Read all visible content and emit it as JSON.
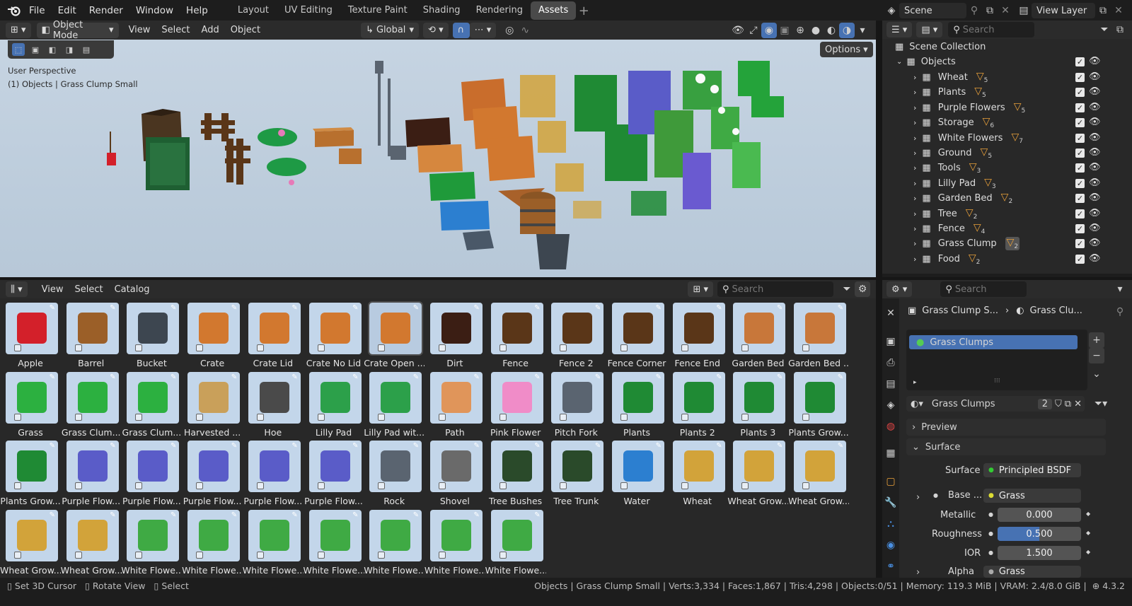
{
  "topbar": {
    "menus": [
      "File",
      "Edit",
      "Render",
      "Window",
      "Help"
    ],
    "workspaces": [
      "Layout",
      "UV Editing",
      "Texture Paint",
      "Shading",
      "Rendering",
      "Assets"
    ],
    "active_workspace": "Assets",
    "scene_name": "Scene",
    "view_layer": "View Layer"
  },
  "viewport": {
    "mode": "Object Mode",
    "menus": [
      "View",
      "Select",
      "Add",
      "Object"
    ],
    "transform_orientation": "Global",
    "options_label": "Options",
    "perspective_label": "User Perspective",
    "context_label": "(1) Objects | Grass Clump Small"
  },
  "outliner": {
    "search_placeholder": "Search",
    "root": "Scene Collection",
    "collection": "Objects",
    "items": [
      {
        "name": "Wheat",
        "count": "5"
      },
      {
        "name": "Plants",
        "count": "5"
      },
      {
        "name": "Purple Flowers",
        "count": "5"
      },
      {
        "name": "Storage",
        "count": "6"
      },
      {
        "name": "White Flowers",
        "count": "7"
      },
      {
        "name": "Ground",
        "count": "5"
      },
      {
        "name": "Tools",
        "count": "3"
      },
      {
        "name": "Lilly Pad",
        "count": "3"
      },
      {
        "name": "Garden Bed",
        "count": "2"
      },
      {
        "name": "Tree",
        "count": "2"
      },
      {
        "name": "Fence",
        "count": "4"
      },
      {
        "name": "Grass Clump",
        "count": "2"
      },
      {
        "name": "Food",
        "count": "2"
      }
    ]
  },
  "asset_browser": {
    "menus": [
      "View",
      "Select",
      "Catalog"
    ],
    "search_placeholder": "Search",
    "assets": [
      "Apple",
      "Barrel",
      "Bucket",
      "Crate",
      "Crate Lid",
      "Crate No Lid",
      "Crate Open ...",
      "Dirt",
      "Fence",
      "Fence 2",
      "Fence Corner",
      "Fence End",
      "Garden Bed",
      "Garden Bed ...",
      "Grass",
      "Grass Clum...",
      "Grass Clum...",
      "Harvested ...",
      "Hoe",
      "Lilly Pad",
      "Lilly Pad wit...",
      "Path",
      "Pink Flower",
      "Pitch Fork",
      "Plants",
      "Plants 2",
      "Plants 3",
      "Plants Grow...",
      "Plants Grow...",
      "Purple Flow...",
      "Purple Flow...",
      "Purple Flow...",
      "Purple Flow...",
      "Purple Flow...",
      "Rock",
      "Shovel",
      "Tree Bushes",
      "Tree Trunk",
      "Water",
      "Wheat",
      "Wheat Grow...",
      "Wheat Grow...",
      "Wheat Grow...",
      "Wheat Grow...",
      "White Flowe...",
      "White Flowe...",
      "White Flowe...",
      "White Flowe...",
      "White Flowe...",
      "White Flowe...",
      "White Flowe..."
    ]
  },
  "properties": {
    "search_placeholder": "Search",
    "breadcrumb_object": "Grass Clump S...",
    "breadcrumb_material": "Grass Clu...",
    "material_slot": "Grass Clumps",
    "material_name": "Grass Clumps",
    "users": "2",
    "preview_label": "Preview",
    "surface_panel": "Surface",
    "surface_label": "Surface",
    "surface_value": "Principled BSDF",
    "base_label": "Base ...",
    "base_value": "Grass",
    "metallic_label": "Metallic",
    "metallic_value": "0.000",
    "roughness_label": "Roughness",
    "roughness_value": "0.500",
    "roughness_fraction": 0.5,
    "ior_label": "IOR",
    "ior_value": "1.500",
    "alpha_label": "Alpha",
    "alpha_value": "Grass"
  },
  "statusbar": {
    "hint1": "Set 3D Cursor",
    "hint2": "Rotate View",
    "hint3": "Select",
    "stats": "Objects | Grass Clump Small | Verts:3,334 | Faces:1,867 | Tris:4,298 | Objects:0/51 | Memory: 119.3 MiB | VRAM: 2.4/8.0 GiB |",
    "version": "4.3.2"
  },
  "colors": {
    "accent": "#4772b3",
    "collection_tri": "#e8a03a",
    "thumb_bg": "#c3d6ea"
  }
}
